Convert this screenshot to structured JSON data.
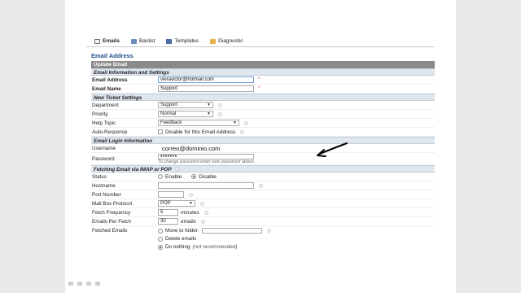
{
  "tabs": [
    {
      "label": "Emails",
      "icon": "mail-icon"
    },
    {
      "label": "Banlist",
      "icon": "banlist-icon"
    },
    {
      "label": "Templates",
      "icon": "templates-icon"
    },
    {
      "label": "Diagnostic",
      "icon": "diagnostic-icon"
    }
  ],
  "page_title": "Email Address",
  "update_bar": "Update Email",
  "info_section": {
    "heading": "Email Information and Settings",
    "email_address_label": "Email Address",
    "email_address_value": "vieravictor@hotmail.com",
    "email_name_label": "Email Name",
    "email_name_value": "Support",
    "required_mark": "*"
  },
  "ticket_section": {
    "heading": "New Ticket Settings",
    "department_label": "Department",
    "department_value": "Support",
    "priority_label": "Priority",
    "priority_value": "Normal",
    "help_topic_label": "Help Topic",
    "help_topic_value": "Feedback",
    "auto_response_label": "Auto-Response",
    "auto_response_text": "Disable for this Email Address"
  },
  "login_section": {
    "heading": "Email Login Information",
    "username_label": "Username",
    "username_value": "correo@dominio.com",
    "password_label": "Password",
    "password_value": "•••••••",
    "password_note": "To change password enter new password above."
  },
  "fetch_section": {
    "heading": "Fetching Email via IMAP or POP",
    "status_label": "Status",
    "status_enable": "Enable",
    "status_disable": "Disable",
    "hostname_label": "Hostname",
    "port_label": "Port Number",
    "protocol_label": "Mail Box Protocol",
    "protocol_value": "POP",
    "frequency_label": "Fetch Frequency",
    "frequency_value": "5",
    "frequency_unit": "minutes",
    "per_fetch_label": "Emails Per Fetch",
    "per_fetch_value": "30",
    "per_fetch_unit": "emails",
    "fetched_label": "Fetched Emails",
    "opt_move": "Move to folder:",
    "opt_delete": "Delete emails",
    "opt_nothing": "Do nothing",
    "opt_nothing_note": "(not recommended)"
  },
  "colors": {
    "section_title": "#1f4f8a",
    "update_bar": "#8a8a8a",
    "subhead_bg": "#dfe6ee"
  }
}
